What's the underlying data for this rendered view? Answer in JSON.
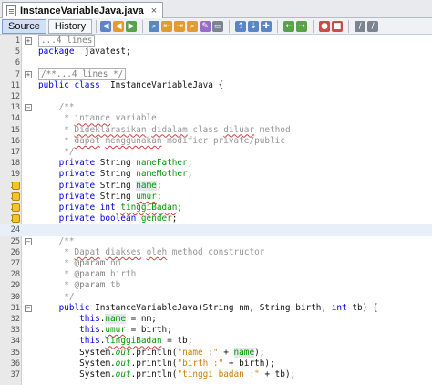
{
  "file_tab": {
    "name": "InstanceVariableJava.java",
    "close": "×"
  },
  "toolbar": {
    "source_label": "Source",
    "history_label": "History",
    "icons": [
      "last-edit-icon",
      "back-icon",
      "forward-icon",
      "find-icon",
      "find-previous-icon",
      "find-next-icon",
      "find-selection-icon",
      "toggle-highlight-icon",
      "toggle-rectangular-icon",
      "previous-bookmark-icon",
      "next-bookmark-icon",
      "toggle-bookmark-icon",
      "shift-left-icon",
      "shift-right-icon",
      "start-macro-icon",
      "stop-macro-icon",
      "comment-icon",
      "uncomment-icon"
    ]
  },
  "colors": {
    "keyword": "#0000e6",
    "comment": "#969696",
    "field": "#009900",
    "string": "#ce7b00",
    "gutter": "#e9e9e9",
    "active_line": "#e9eff8"
  },
  "lines": [
    {
      "n": "1",
      "fold": "+",
      "mk": false,
      "hl": false,
      "p": [
        [
          "cmb",
          "...4 lines"
        ]
      ]
    },
    {
      "n": "5",
      "fold": "",
      "mk": false,
      "hl": false,
      "p": [
        [
          "kw",
          "package"
        ],
        [
          "",
          "  javatest;"
        ]
      ]
    },
    {
      "n": "6",
      "fold": "",
      "mk": false,
      "hl": false,
      "p": []
    },
    {
      "n": "7",
      "fold": "+",
      "mk": false,
      "hl": false,
      "p": [
        [
          "cmb",
          "/**...4 lines */"
        ]
      ]
    },
    {
      "n": "11",
      "fold": "",
      "mk": false,
      "hl": false,
      "p": [
        [
          "kw",
          "public class"
        ],
        [
          "",
          "  InstanceVariableJava {"
        ]
      ]
    },
    {
      "n": "12",
      "fold": "",
      "mk": false,
      "hl": false,
      "p": []
    },
    {
      "n": "13",
      "fold": "-",
      "mk": false,
      "hl": false,
      "p": [
        [
          "cm",
          "    /**"
        ]
      ]
    },
    {
      "n": "14",
      "fold": "",
      "mk": false,
      "hl": false,
      "p": [
        [
          "cm",
          "     * "
        ],
        [
          "cm ul",
          "intance"
        ],
        [
          "cm",
          " variable"
        ]
      ]
    },
    {
      "n": "15",
      "fold": "",
      "mk": false,
      "hl": false,
      "p": [
        [
          "cm",
          "     * "
        ],
        [
          "cm ul",
          "Dideklarasikan"
        ],
        [
          "cm",
          " "
        ],
        [
          "cm ul",
          "didalam"
        ],
        [
          "cm",
          " class "
        ],
        [
          "cm ul",
          "diluar"
        ],
        [
          "cm",
          " method"
        ]
      ]
    },
    {
      "n": "16",
      "fold": "",
      "mk": false,
      "hl": false,
      "p": [
        [
          "cm",
          "     * "
        ],
        [
          "cm ul",
          "dapat"
        ],
        [
          "cm",
          " "
        ],
        [
          "cm ul",
          "menggunakan"
        ],
        [
          "cm",
          " modifier private/public"
        ]
      ]
    },
    {
      "n": "17",
      "fold": "",
      "mk": false,
      "hl": false,
      "p": [
        [
          "cm",
          "     */"
        ]
      ]
    },
    {
      "n": "18",
      "fold": "",
      "mk": false,
      "hl": false,
      "p": [
        [
          "kw",
          "    private"
        ],
        [
          "",
          " String "
        ],
        [
          "fld",
          "nameFather"
        ],
        [
          "",
          ";"
        ]
      ]
    },
    {
      "n": "19",
      "fold": "",
      "mk": false,
      "hl": false,
      "p": [
        [
          "kw",
          "    private"
        ],
        [
          "",
          " String "
        ],
        [
          "fld",
          "nameMother"
        ],
        [
          "",
          ";"
        ]
      ]
    },
    {
      "n": "20",
      "fold": "",
      "mk": true,
      "hl": false,
      "p": [
        [
          "kw",
          "    private"
        ],
        [
          "",
          " String "
        ],
        [
          "fld sel",
          "name"
        ],
        [
          "",
          ";"
        ]
      ]
    },
    {
      "n": "21",
      "fold": "",
      "mk": true,
      "hl": false,
      "p": [
        [
          "kw",
          "    private"
        ],
        [
          "",
          " String "
        ],
        [
          "fld ul",
          "umur"
        ],
        [
          "",
          ";"
        ]
      ]
    },
    {
      "n": "22",
      "fold": "",
      "mk": true,
      "hl": false,
      "p": [
        [
          "kw",
          "    private int"
        ],
        [
          "",
          " "
        ],
        [
          "fld ul",
          "tinggiBadan"
        ],
        [
          "",
          ";"
        ]
      ]
    },
    {
      "n": "23",
      "fold": "",
      "mk": true,
      "hl": false,
      "p": [
        [
          "kw",
          "    private boolean"
        ],
        [
          "",
          " "
        ],
        [
          "fld",
          "gender"
        ],
        [
          "",
          ";"
        ]
      ]
    },
    {
      "n": "24",
      "fold": "",
      "mk": false,
      "hl": true,
      "p": []
    },
    {
      "n": "25",
      "fold": "-",
      "mk": false,
      "hl": false,
      "p": [
        [
          "cm",
          "    /**"
        ]
      ]
    },
    {
      "n": "26",
      "fold": "",
      "mk": false,
      "hl": false,
      "p": [
        [
          "cm",
          "     * "
        ],
        [
          "cm ul",
          "Dapat"
        ],
        [
          "cm",
          " "
        ],
        [
          "cm ul",
          "diakses"
        ],
        [
          "cm",
          " "
        ],
        [
          "cm ul",
          "oleh"
        ],
        [
          "cm",
          " method constructor"
        ]
      ]
    },
    {
      "n": "27",
      "fold": "",
      "mk": false,
      "hl": false,
      "p": [
        [
          "cm",
          "     * "
        ],
        [
          "tg",
          "@param"
        ],
        [
          "cm",
          " nm"
        ]
      ]
    },
    {
      "n": "28",
      "fold": "",
      "mk": false,
      "hl": false,
      "p": [
        [
          "cm",
          "     * "
        ],
        [
          "tg",
          "@param"
        ],
        [
          "cm",
          " birth"
        ]
      ]
    },
    {
      "n": "29",
      "fold": "",
      "mk": false,
      "hl": false,
      "p": [
        [
          "cm",
          "     * "
        ],
        [
          "tg",
          "@param"
        ],
        [
          "cm",
          " tb"
        ]
      ]
    },
    {
      "n": "30",
      "fold": "",
      "mk": false,
      "hl": false,
      "p": [
        [
          "cm",
          "     */"
        ]
      ]
    },
    {
      "n": "31",
      "fold": "-",
      "mk": false,
      "hl": false,
      "p": [
        [
          "kw",
          "    public"
        ],
        [
          "",
          " InstanceVariableJava(String nm, String birth, "
        ],
        [
          "kw",
          "int"
        ],
        [
          "",
          " tb) {"
        ]
      ]
    },
    {
      "n": "32",
      "fold": "",
      "mk": false,
      "hl": false,
      "p": [
        [
          "kw",
          "        this"
        ],
        [
          "",
          "."
        ],
        [
          "fld sel",
          "name"
        ],
        [
          "",
          " = nm;"
        ]
      ]
    },
    {
      "n": "33",
      "fold": "",
      "mk": false,
      "hl": false,
      "p": [
        [
          "kw",
          "        this"
        ],
        [
          "",
          "."
        ],
        [
          "fld ul",
          "umur"
        ],
        [
          "",
          " = birth;"
        ]
      ]
    },
    {
      "n": "34",
      "fold": "",
      "mk": false,
      "hl": false,
      "p": [
        [
          "kw",
          "        this"
        ],
        [
          "",
          "."
        ],
        [
          "fld ul",
          "tinggiBadan"
        ],
        [
          "",
          " = tb;"
        ]
      ]
    },
    {
      "n": "35",
      "fold": "",
      "mk": false,
      "hl": false,
      "p": [
        [
          "",
          "        System."
        ],
        [
          "fld it",
          "out"
        ],
        [
          "",
          ".println("
        ],
        [
          "st",
          "\"name :\""
        ],
        [
          "",
          " + "
        ],
        [
          "fld sel",
          "name"
        ],
        [
          "",
          ");"
        ]
      ]
    },
    {
      "n": "36",
      "fold": "",
      "mk": false,
      "hl": false,
      "p": [
        [
          "",
          "        System."
        ],
        [
          "fld it",
          "out"
        ],
        [
          "",
          ".println("
        ],
        [
          "st",
          "\"birth :\""
        ],
        [
          "",
          " + birth);"
        ]
      ]
    },
    {
      "n": "37",
      "fold": "",
      "mk": false,
      "hl": false,
      "p": [
        [
          "",
          "        System."
        ],
        [
          "fld it",
          "out"
        ],
        [
          "",
          ".println("
        ],
        [
          "st",
          "\"tinggi badan :\""
        ],
        [
          "",
          " + tb);"
        ]
      ]
    }
  ]
}
